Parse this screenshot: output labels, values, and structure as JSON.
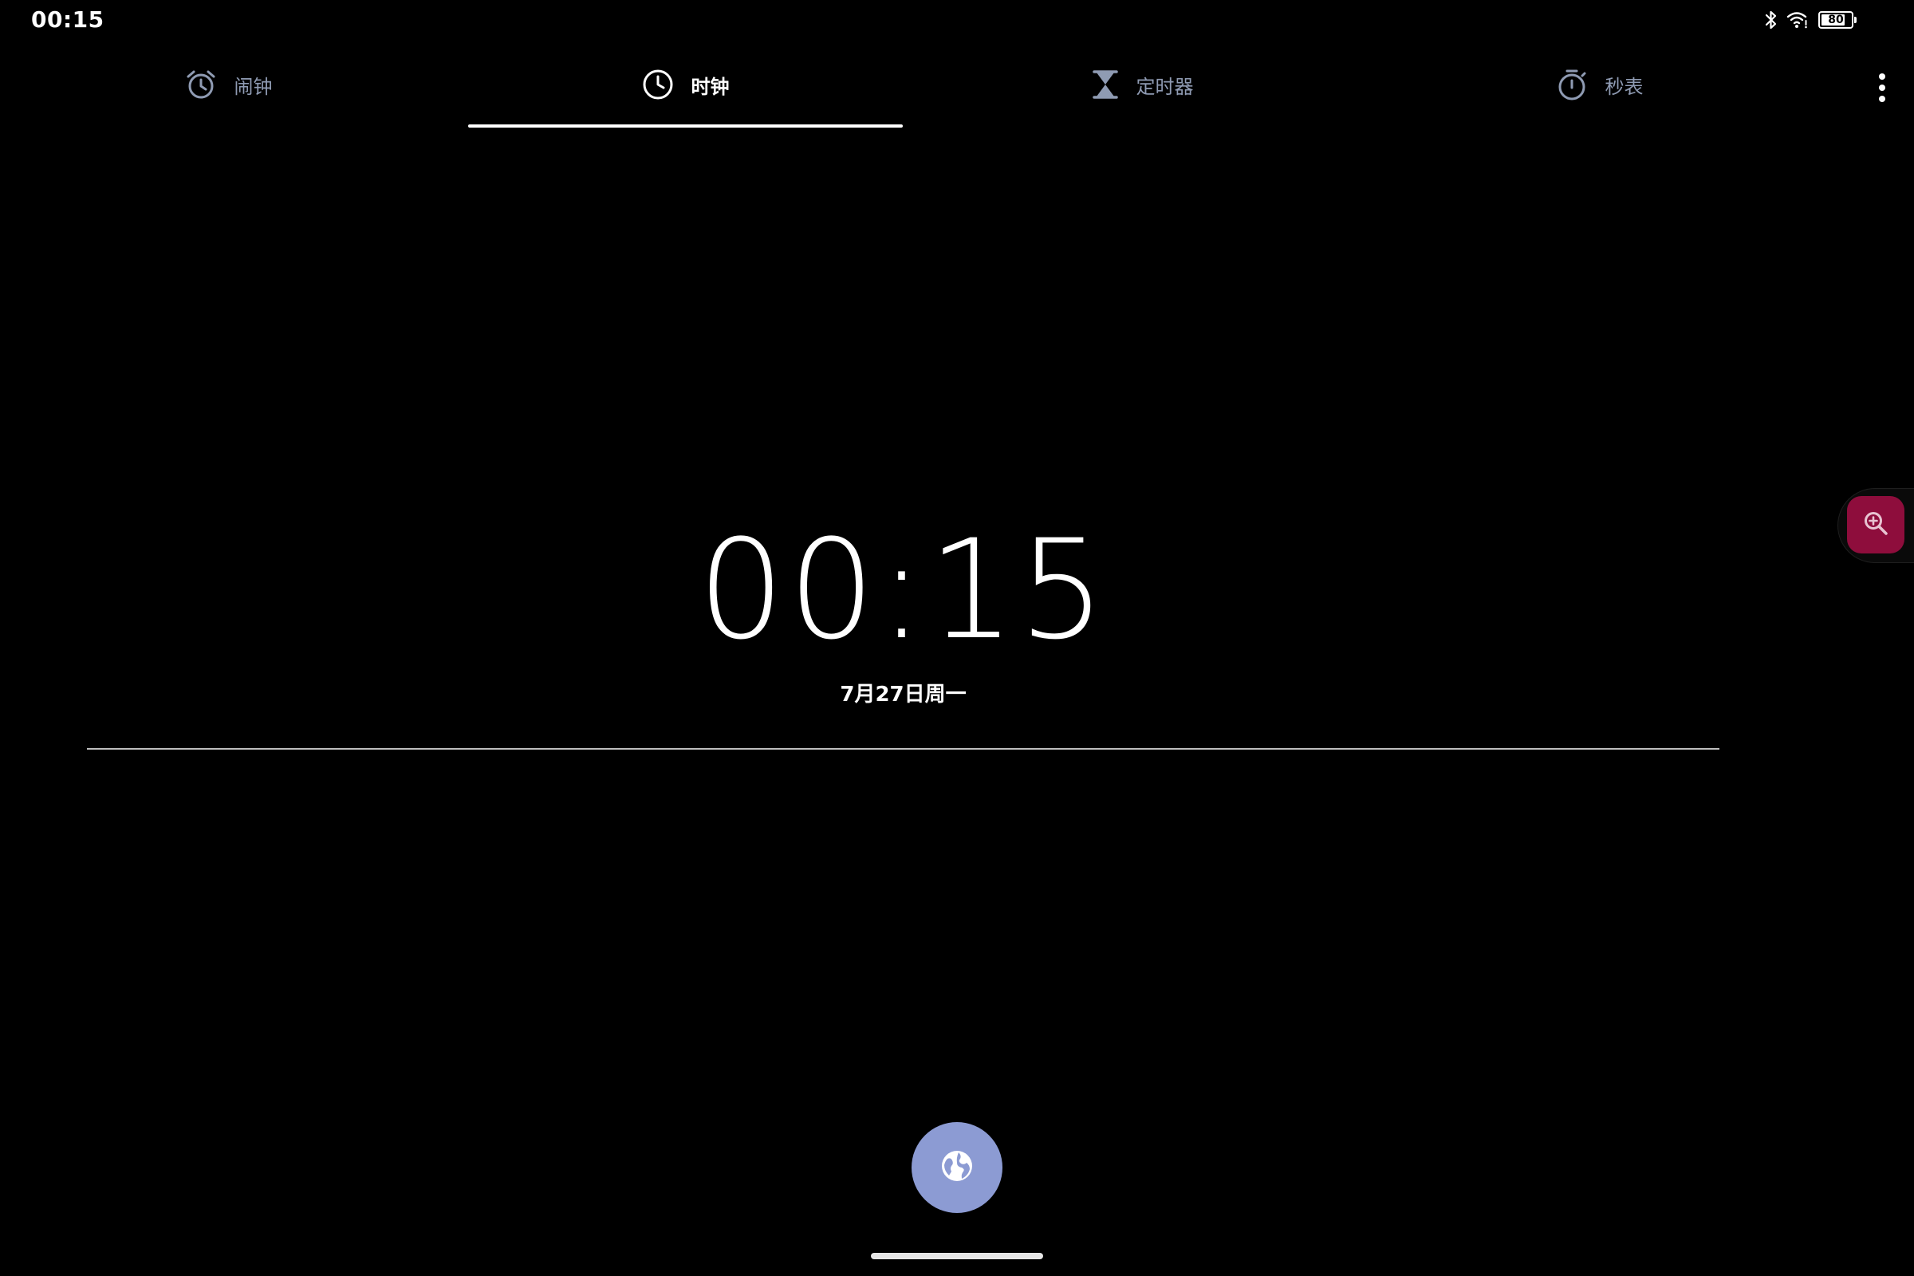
{
  "status_bar": {
    "time": "00:15",
    "battery_level": "80",
    "battery_fraction": 0.8,
    "icons": [
      "bluetooth-icon",
      "wifi-icon",
      "battery-icon"
    ]
  },
  "tabs": [
    {
      "label": "闹钟",
      "icon": "alarm-icon",
      "active": false
    },
    {
      "label": "时钟",
      "icon": "clock-icon",
      "active": true
    },
    {
      "label": "定时器",
      "icon": "hourglass-icon",
      "active": false
    },
    {
      "label": "秒表",
      "icon": "stopwatch-icon",
      "active": false
    }
  ],
  "clock": {
    "time": "00:15",
    "date": "7月27日周一"
  },
  "fab": {
    "icon": "globe-icon"
  },
  "side_tool": {
    "icon": "zoom-in-icon"
  },
  "colors": {
    "background": "#000000",
    "inactive_tab": "#8f9bb3",
    "active_tab": "#ffffff",
    "fab": "#8c9bd3",
    "zoom_button": "#8e0d3c"
  }
}
